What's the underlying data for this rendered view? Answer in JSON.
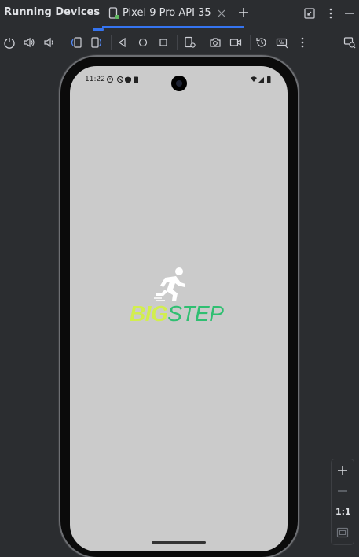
{
  "panel": {
    "title": "Running Devices"
  },
  "tab": {
    "label": "Pixel 9 Pro API 35",
    "icon": "phone-device-icon"
  },
  "header_icons": [
    "add-tab-icon",
    "restore-window-icon",
    "more-vert-icon",
    "minimize-icon"
  ],
  "toolbar": {
    "icons": [
      "power-icon",
      "volume-up-icon",
      "volume-down-icon",
      "rotate-left-icon",
      "rotate-right-icon",
      "back-icon",
      "home-icon",
      "overview-icon",
      "device-settings-icon",
      "screenshot-camera-icon",
      "screen-record-icon",
      "snapshot-restore-icon",
      "keyboard-icon",
      "more-vert-icon",
      "device-mirror-icon"
    ]
  },
  "device": {
    "status_time": "11:22",
    "app_logo": {
      "part1": "BIG",
      "part2": "STEP"
    },
    "colors": {
      "screen_bg": "#cbcbcb",
      "logo_big": "#d2ee4e",
      "logo_step": "#2fbf71"
    }
  },
  "zoom": {
    "ratio_label": "1:1"
  }
}
